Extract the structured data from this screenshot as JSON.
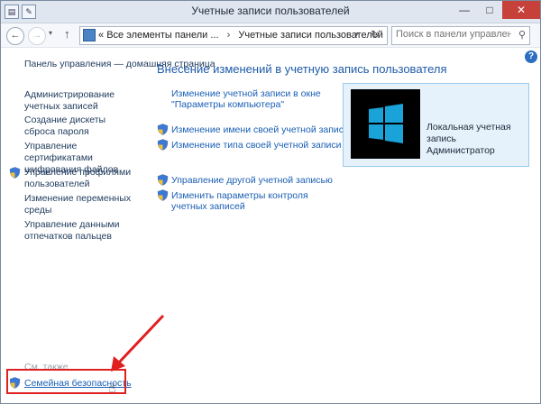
{
  "window": {
    "title": "Учетные записи пользователей",
    "minimize_glyph": "—",
    "maximize_glyph": "□",
    "close_glyph": "✕"
  },
  "navigation": {
    "back_glyph": "←",
    "forward_glyph": "→",
    "up_glyph": "↑",
    "history_glyph": "▾",
    "breadcrumb_prefix": "«",
    "breadcrumb": [
      "Все элементы панели ...",
      "Учетные записи пользователей"
    ],
    "breadcrumb_separator": "›",
    "refresh_glyph": "↻",
    "search_placeholder": "Поиск в панели управления"
  },
  "help_glyph": "?",
  "sidebar": {
    "home_label": "Панель управления — домашняя страница",
    "items": [
      {
        "label": "Администрирование учетных записей",
        "icon": "none"
      },
      {
        "label": "Создание дискеты сброса пароля",
        "icon": "none"
      },
      {
        "label": "Управление сертификатами шифрования файлов",
        "icon": "none"
      },
      {
        "label": "Управление профилями пользователей",
        "icon": "shield-icon"
      },
      {
        "label": "Изменение переменных среды",
        "icon": "none"
      },
      {
        "label": "Управление данными отпечатков пальцев",
        "icon": "none"
      }
    ],
    "see_also_label": "См. также",
    "family_safety_label": "Семейная безопасность"
  },
  "main": {
    "title": "Внесение изменений в учетную запись пользователя",
    "links": [
      {
        "label": "Изменение учетной записи в окне \"Параметры компьютера\"",
        "icon": "none"
      },
      {
        "label": "Изменение имени своей учетной записи",
        "icon": "shield-icon"
      },
      {
        "label": "Изменение типа своей учетной записи",
        "icon": "shield-icon"
      },
      {
        "label": "Управление другой учетной записью",
        "icon": "shield-icon"
      },
      {
        "label": "Изменить параметры контроля учетных записей",
        "icon": "shield-icon"
      }
    ]
  },
  "user_card": {
    "account_type": "Локальная учетная запись",
    "role": "Администратор"
  },
  "colors": {
    "link": "#1a5fb4",
    "title": "#1e5aa8",
    "highlight": "#e01f1f",
    "windows_tile": "#19a3d8"
  }
}
